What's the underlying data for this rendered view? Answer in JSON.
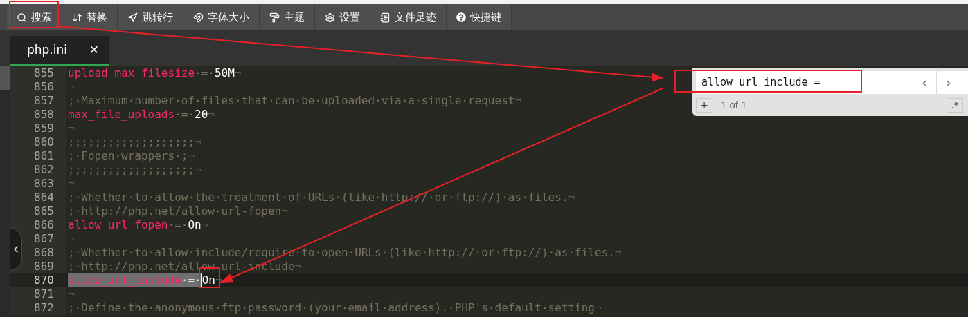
{
  "toolbar": [
    {
      "kind": "search",
      "label": "搜索"
    },
    {
      "kind": "replace",
      "label": "替换"
    },
    {
      "kind": "goto",
      "label": "跳转行"
    },
    {
      "kind": "font",
      "label": "字体大小"
    },
    {
      "kind": "theme",
      "label": "主题"
    },
    {
      "kind": "settings",
      "label": "设置"
    },
    {
      "kind": "history",
      "label": "文件足迹"
    },
    {
      "kind": "help",
      "label": "快捷键"
    }
  ],
  "tabs": [
    {
      "label": "php.ini",
      "selected": true
    }
  ],
  "close_glyph": "✕",
  "lines": [
    {
      "number": "855",
      "current": false,
      "tokens": [
        {
          "kind": "key",
          "text": "upload_max_filesize"
        },
        {
          "kind": "op",
          "text": "·=·"
        },
        {
          "kind": "value",
          "text": "50M"
        },
        {
          "kind": "eol",
          "text": "¬"
        }
      ]
    },
    {
      "number": "856",
      "current": false,
      "tokens": [
        {
          "kind": "eol",
          "text": "¬"
        }
      ]
    },
    {
      "number": "857",
      "current": false,
      "tokens": [
        {
          "kind": "comment",
          "text": ";·Maximum·number·of·files·that·can·be·uploaded·via·a·single·request"
        },
        {
          "kind": "eol",
          "text": "¬"
        }
      ]
    },
    {
      "number": "858",
      "current": false,
      "tokens": [
        {
          "kind": "key",
          "text": "max_file_uploads"
        },
        {
          "kind": "op",
          "text": "·=·"
        },
        {
          "kind": "value",
          "text": "20"
        },
        {
          "kind": "eol",
          "text": "¬"
        }
      ]
    },
    {
      "number": "859",
      "current": false,
      "tokens": [
        {
          "kind": "eol",
          "text": "¬"
        }
      ]
    },
    {
      "number": "860",
      "current": false,
      "tokens": [
        {
          "kind": "comment",
          "text": ";;;;;;;;;;;;;;;;;;;"
        },
        {
          "kind": "eol",
          "text": "¬"
        }
      ]
    },
    {
      "number": "861",
      "current": false,
      "tokens": [
        {
          "kind": "comment",
          "text": ";·Fopen·wrappers·;"
        },
        {
          "kind": "eol",
          "text": "¬"
        }
      ]
    },
    {
      "number": "862",
      "current": false,
      "tokens": [
        {
          "kind": "comment",
          "text": ";;;;;;;;;;;;;;;;;;;"
        },
        {
          "kind": "eol",
          "text": "¬"
        }
      ]
    },
    {
      "number": "863",
      "current": false,
      "tokens": [
        {
          "kind": "eol",
          "text": "¬"
        }
      ]
    },
    {
      "number": "864",
      "current": false,
      "tokens": [
        {
          "kind": "comment",
          "text": ";·Whether·to·allow·the·treatment·of·URLs·(like·http://·or·ftp://)·as·files."
        },
        {
          "kind": "eol",
          "text": "¬"
        }
      ]
    },
    {
      "number": "865",
      "current": false,
      "tokens": [
        {
          "kind": "comment",
          "text": ";·http://php.net/allow-url-fopen"
        },
        {
          "kind": "eol",
          "text": "¬"
        }
      ]
    },
    {
      "number": "866",
      "current": false,
      "tokens": [
        {
          "kind": "key",
          "text": "allow_url_fopen"
        },
        {
          "kind": "op",
          "text": "·=·"
        },
        {
          "kind": "value",
          "text": "On"
        },
        {
          "kind": "eol",
          "text": "¬"
        }
      ]
    },
    {
      "number": "867",
      "current": false,
      "tokens": [
        {
          "kind": "eol",
          "text": "¬"
        }
      ]
    },
    {
      "number": "868",
      "current": false,
      "tokens": [
        {
          "kind": "comment",
          "text": ";·Whether·to·allow·include/require·to·open·URLs·(like·http://·or·ftp://)·as·files."
        },
        {
          "kind": "eol",
          "text": "¬"
        }
      ]
    },
    {
      "number": "869",
      "current": false,
      "tokens": [
        {
          "kind": "comment",
          "text": ";·http://php.net/allow-url-include"
        },
        {
          "kind": "eol",
          "text": "¬"
        }
      ]
    },
    {
      "number": "870",
      "current": true,
      "tokens": [
        {
          "kind": "key",
          "text": "allow_url_include",
          "selected": true
        },
        {
          "kind": "op",
          "text": "·=·",
          "selected": true
        },
        {
          "kind": "value",
          "text": "On"
        },
        {
          "kind": "eol",
          "text": "¬"
        }
      ]
    },
    {
      "number": "871",
      "current": false,
      "tokens": [
        {
          "kind": "eol",
          "text": "¬"
        }
      ]
    },
    {
      "number": "872",
      "current": false,
      "tokens": [
        {
          "kind": "comment",
          "text": ";·Define·the·anonymous·ftp·password·(your·email·address).·PHP's·default·setting"
        },
        {
          "kind": "eol",
          "text": "¬"
        }
      ]
    }
  ],
  "find_panel": {
    "value": "allow_url_include = ",
    "prev": "‹",
    "next": "›",
    "add": "+",
    "count": "1 of 1",
    "regex": ".*"
  }
}
